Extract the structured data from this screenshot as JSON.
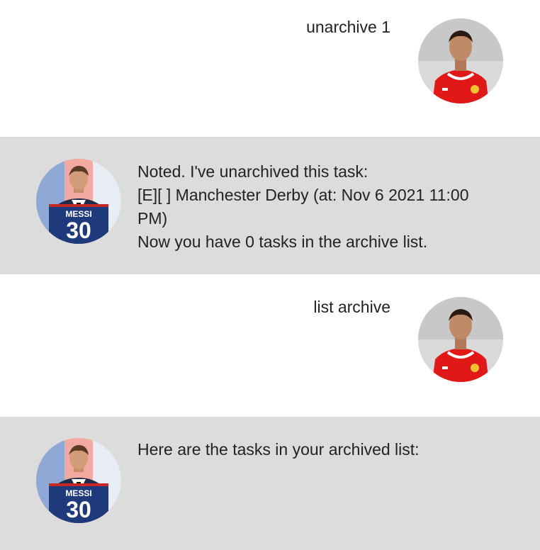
{
  "messages": [
    {
      "sender": "user",
      "avatar": "ronaldo-avatar",
      "text": "unarchive 1"
    },
    {
      "sender": "bot",
      "avatar": "messi-avatar",
      "text": "Noted. I've unarchived this task:\n[E][ ] Manchester Derby (at: Nov 6 2021 11:00\nPM)\nNow you have 0 tasks in the archive list."
    },
    {
      "sender": "user",
      "avatar": "ronaldo-avatar",
      "text": "list archive"
    },
    {
      "sender": "bot",
      "avatar": "messi-avatar",
      "text": "Here are the tasks in your archived list:"
    }
  ],
  "avatar_labels": {
    "messi_jersey_name": "MESSI",
    "messi_jersey_number": "30"
  },
  "colors": {
    "bot_row_bg": "#dcdcdc",
    "user_row_bg": "#ffffff",
    "text": "#222222"
  }
}
